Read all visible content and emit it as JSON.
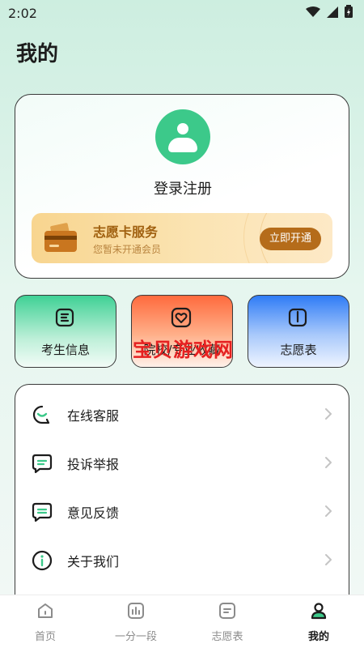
{
  "status_bar": {
    "time": "2:02"
  },
  "page": {
    "title": "我的"
  },
  "profile": {
    "login_text": "登录注册",
    "vip": {
      "title": "志愿卡服务",
      "subtitle": "您暂未开通会员",
      "button": "立即开通"
    }
  },
  "tiles": [
    {
      "label": "考生信息",
      "icon": "list-icon"
    },
    {
      "label": "院校/专业收藏",
      "icon": "heart-icon"
    },
    {
      "label": "志愿表",
      "icon": "book-icon"
    }
  ],
  "watermark": "宝贝游戏网",
  "menu": [
    {
      "label": "在线客服",
      "icon": "headset-icon"
    },
    {
      "label": "投诉举报",
      "icon": "chat-icon"
    },
    {
      "label": "意见反馈",
      "icon": "feedback-icon"
    },
    {
      "label": "关于我们",
      "icon": "info-icon"
    }
  ],
  "bottom_nav": [
    {
      "label": "首页",
      "icon": "home-icon",
      "active": false
    },
    {
      "label": "一分一段",
      "icon": "chart-icon",
      "active": false
    },
    {
      "label": "志愿表",
      "icon": "form-icon",
      "active": false
    },
    {
      "label": "我的",
      "icon": "person-icon",
      "active": true
    }
  ],
  "colors": {
    "accent": "#3cc98a",
    "vip_text": "#a0600f",
    "vip_button": "#b56c1a"
  }
}
